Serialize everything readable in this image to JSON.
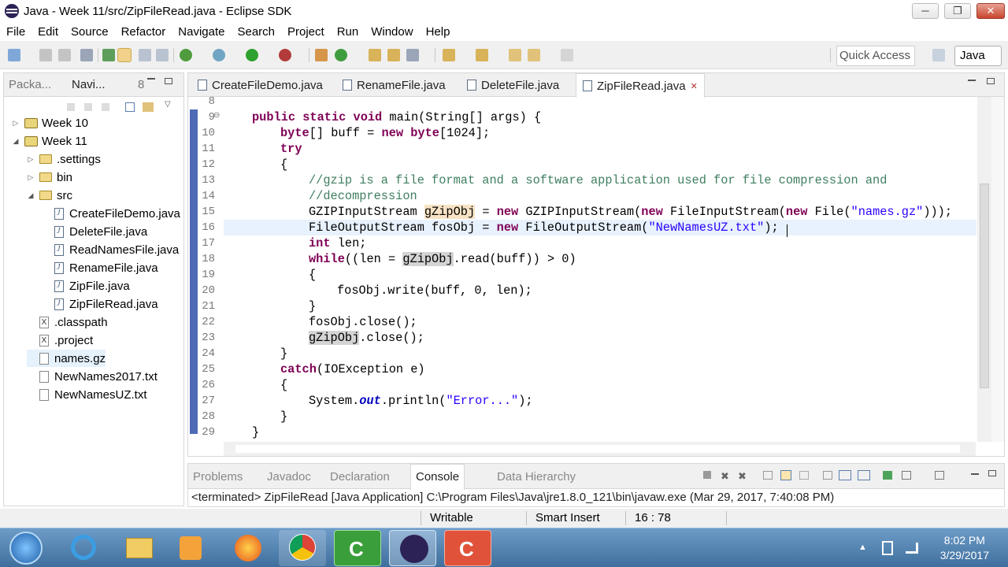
{
  "window": {
    "title": "Java - Week 11/src/ZipFileRead.java - Eclipse SDK",
    "min": "─",
    "max": "❐",
    "close": "✕"
  },
  "menu": [
    "File",
    "Edit",
    "Source",
    "Refactor",
    "Navigate",
    "Search",
    "Project",
    "Run",
    "Window",
    "Help"
  ],
  "toolbar": {
    "quick_access": "Quick Access",
    "perspective": "Java"
  },
  "left_tabs": {
    "package": "Packa...",
    "navigator": "Navi...",
    "extra": "8"
  },
  "tree": [
    {
      "label": "Week 10",
      "indent": 0,
      "twisty": "▷",
      "icon": "project"
    },
    {
      "label": "Week 11",
      "indent": 0,
      "twisty": "◢",
      "icon": "project"
    },
    {
      "label": ".settings",
      "indent": 1,
      "twisty": "▷",
      "icon": "folder"
    },
    {
      "label": "bin",
      "indent": 1,
      "twisty": "▷",
      "icon": "folder"
    },
    {
      "label": "src",
      "indent": 1,
      "twisty": "◢",
      "icon": "folder"
    },
    {
      "label": "CreateFileDemo.java",
      "indent": 2,
      "twisty": "",
      "icon": "java"
    },
    {
      "label": "DeleteFile.java",
      "indent": 2,
      "twisty": "",
      "icon": "java"
    },
    {
      "label": "ReadNamesFile.java",
      "indent": 2,
      "twisty": "",
      "icon": "java"
    },
    {
      "label": "RenameFile.java",
      "indent": 2,
      "twisty": "",
      "icon": "java"
    },
    {
      "label": "ZipFile.java",
      "indent": 2,
      "twisty": "",
      "icon": "java"
    },
    {
      "label": "ZipFileRead.java",
      "indent": 2,
      "twisty": "",
      "icon": "java"
    },
    {
      "label": ".classpath",
      "indent": 1,
      "twisty": "",
      "icon": "x"
    },
    {
      "label": ".project",
      "indent": 1,
      "twisty": "",
      "icon": "x"
    },
    {
      "label": "names.gz",
      "indent": 1,
      "twisty": "",
      "icon": "file",
      "selected": true
    },
    {
      "label": "NewNames2017.txt",
      "indent": 1,
      "twisty": "",
      "icon": "file"
    },
    {
      "label": "NewNamesUZ.txt",
      "indent": 1,
      "twisty": "",
      "icon": "file"
    }
  ],
  "editor_tabs": [
    "CreateFileDemo.java",
    "RenameFile.java",
    "DeleteFile.java",
    "ZipFileRead.java"
  ],
  "active_tab_close": "✕",
  "line_numbers": [
    "8",
    "9",
    "10",
    "11",
    "12",
    "13",
    "14",
    "15",
    "16",
    "17",
    "18",
    "19",
    "20",
    "21",
    "22",
    "23",
    "24",
    "25",
    "26",
    "27",
    "28",
    "29"
  ],
  "fold_marker": "⊖",
  "code": {
    "l9a": "public static void",
    "l9b": " main(String[] args) {",
    "l10a": "byte",
    "l10b": "[] buff = ",
    "l10c": "new",
    "l10d": " ",
    "l10e": "byte",
    "l10f": "[1024];",
    "l11": "try",
    "l12": "{",
    "l13": "//gzip is a file format and a software application used for file compression and",
    "l14": "//decompression",
    "l15a": "GZIPInputStream ",
    "l15b": "gZipObj",
    "l15c": " = ",
    "l15d": "new",
    "l15e": " GZIPInputStream(",
    "l15f": "new",
    "l15g": " FileInputStream(",
    "l15h": "new",
    "l15i": " File(",
    "l15j": "\"names.gz\"",
    "l15k": ")));",
    "l16a": "FileOutputStream fosObj = ",
    "l16b": "new",
    "l16c": " FileOutputStream(",
    "l16d": "\"NewNamesUZ.txt\"",
    "l16e": ");",
    "l17a": "int",
    "l17b": " len;",
    "l18a": "while",
    "l18b": "((len = ",
    "l18c": "gZipObj",
    "l18d": ".read(buff)) > 0)",
    "l19": "{",
    "l20": "fosObj.write(buff, 0, len);",
    "l21": "}",
    "l22": "fosObj.close();",
    "l23a": "gZipObj",
    "l23b": ".close();",
    "l24": "}",
    "l25a": "catch",
    "l25b": "(IOException e)",
    "l26": "{",
    "l27a": "System.",
    "l27b": "out",
    "l27c": ".println(",
    "l27d": "\"Error...\"",
    "l27e": ");",
    "l28": "}",
    "l29": "}"
  },
  "console_tabs": {
    "problems": "Problems",
    "javadoc": "Javadoc",
    "declaration": "Declaration",
    "console": "Console",
    "hierarchy": "Data Hierarchy"
  },
  "console_line": "<terminated> ZipFileRead [Java Application] C:\\Program Files\\Java\\jre1.8.0_121\\bin\\javaw.exe (Mar 29, 2017, 7:40:08 PM)",
  "status": {
    "writable": "Writable",
    "insert": "Smart Insert",
    "position": "16 : 78"
  },
  "clock": {
    "time": "8:02 PM",
    "date": "3/29/2017"
  }
}
